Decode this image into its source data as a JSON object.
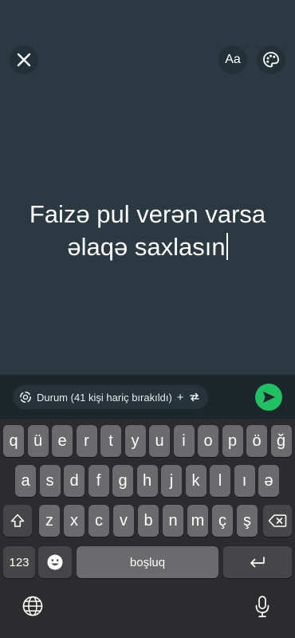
{
  "header": {
    "close_icon": "close-icon",
    "font_button_label": "Aa",
    "palette_icon": "palette-icon"
  },
  "status": {
    "line1": "Faizə pul verən varsa",
    "line2": "əlaqə saxlasın"
  },
  "bottom_bar": {
    "privacy_label": "Durum (41 kişi hariç bırakıldı)",
    "privacy_icon": "status-ring-icon",
    "plus": "+",
    "swap_icon": "swap-icon",
    "send_icon": "send-icon",
    "send_color": "#21c063"
  },
  "keyboard": {
    "row1": [
      "q",
      "ü",
      "e",
      "r",
      "t",
      "y",
      "u",
      "i",
      "o",
      "p",
      "ö",
      "ğ"
    ],
    "row2": [
      "a",
      "s",
      "d",
      "f",
      "g",
      "h",
      "j",
      "k",
      "l",
      "ı",
      "ə"
    ],
    "row3": [
      "z",
      "x",
      "c",
      "v",
      "b",
      "n",
      "m",
      "ç",
      "ş"
    ],
    "numbers_key": "123",
    "space_label": "boşluq",
    "emoji_icon": "emoji-icon",
    "shift_icon": "shift-icon",
    "backspace_icon": "backspace-icon",
    "return_icon": "return-icon",
    "globe_icon": "globe-icon",
    "mic_icon": "mic-icon"
  }
}
